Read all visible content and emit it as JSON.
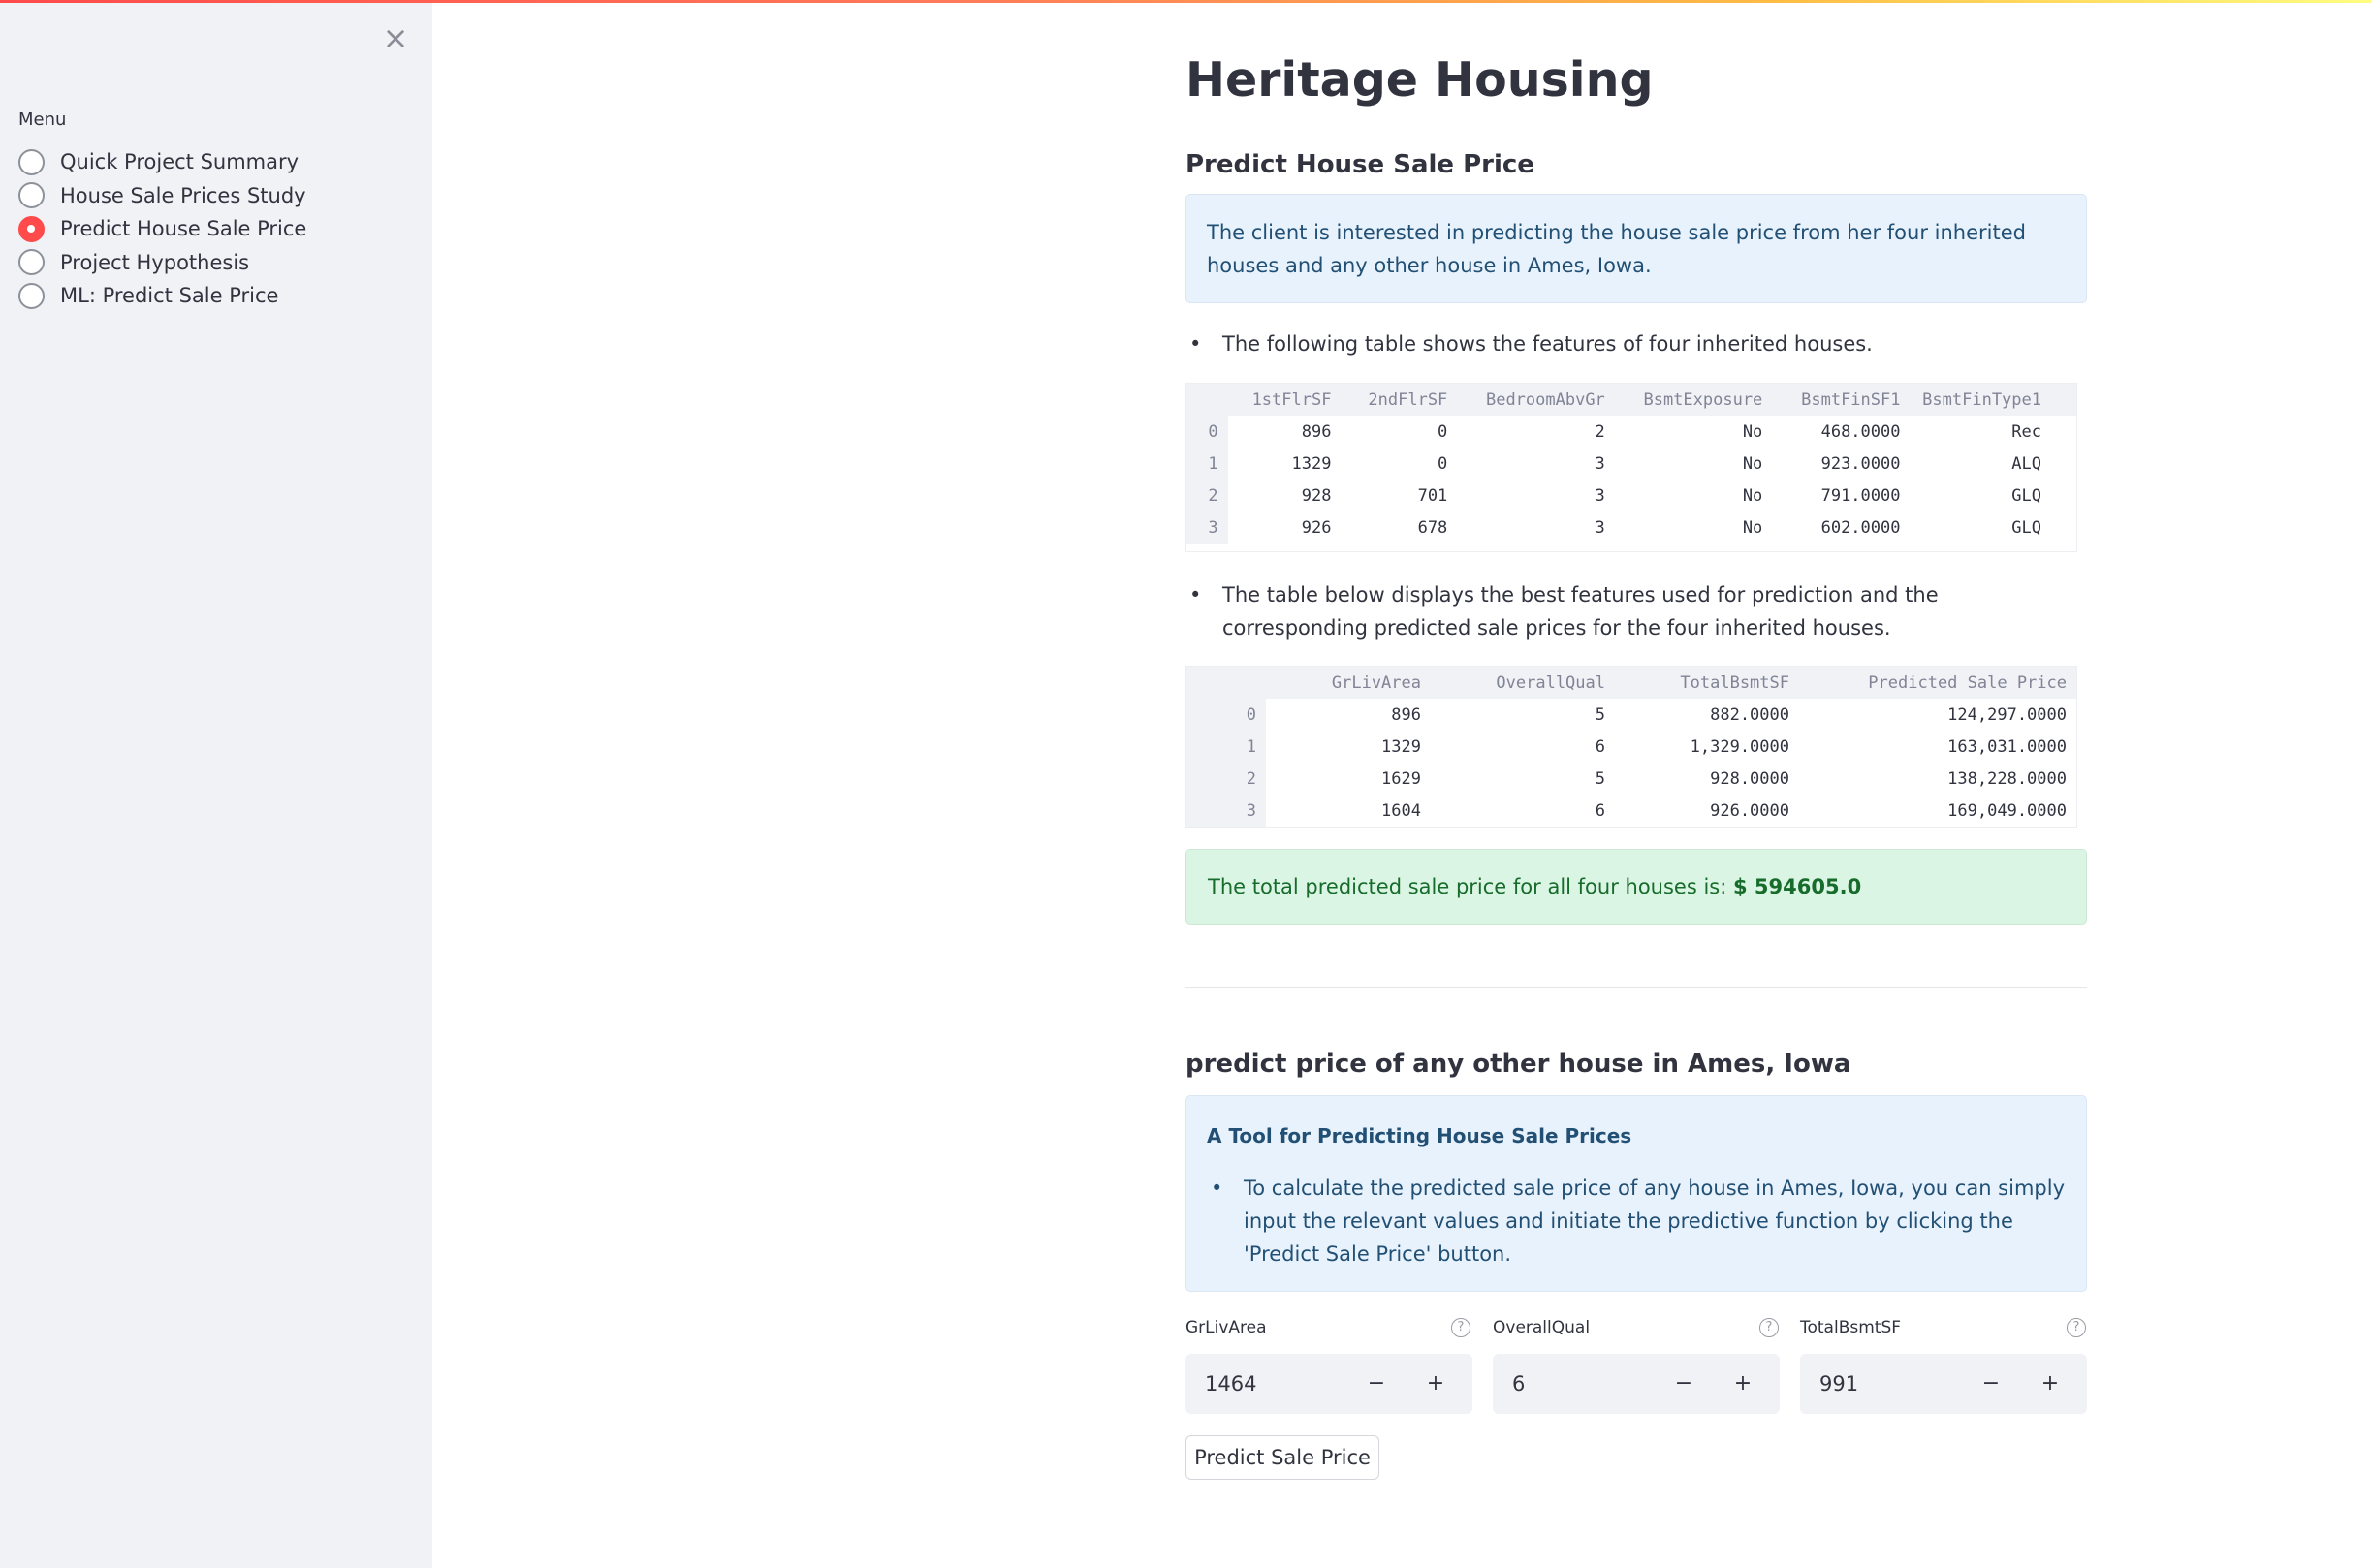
{
  "sidebar": {
    "close_icon": "×",
    "menu_label": "Menu",
    "items": [
      {
        "label": "Quick Project Summary",
        "selected": false
      },
      {
        "label": "House Sale Prices Study",
        "selected": false
      },
      {
        "label": "Predict House Sale Price",
        "selected": true
      },
      {
        "label": "Project Hypothesis",
        "selected": false
      },
      {
        "label": "ML: Predict Sale Price",
        "selected": false
      }
    ]
  },
  "main": {
    "title": "Heritage Housing",
    "subtitle": "Predict House Sale Price",
    "info_text": "The client is interested in predicting the house sale price from her four inherited houses and any other house in Ames, Iowa.",
    "bullet1": "The following table shows the features of four inherited houses.",
    "table1": {
      "columns": [
        "1stFlrSF",
        "2ndFlrSF",
        "BedroomAbvGr",
        "BsmtExposure",
        "BsmtFinSF1",
        "BsmtFinType1"
      ],
      "rows": [
        [
          "0",
          "896",
          "0",
          "2",
          "No",
          "468.0000",
          "Rec"
        ],
        [
          "1",
          "1329",
          "0",
          "3",
          "No",
          "923.0000",
          "ALQ"
        ],
        [
          "2",
          "928",
          "701",
          "3",
          "No",
          "791.0000",
          "GLQ"
        ],
        [
          "3",
          "926",
          "678",
          "3",
          "No",
          "602.0000",
          "GLQ"
        ]
      ]
    },
    "bullet2": "The table below displays the best features used for prediction and the corresponding predicted sale prices for the four inherited houses.",
    "table2": {
      "columns": [
        "GrLivArea",
        "OverallQual",
        "TotalBsmtSF",
        "Predicted Sale Price"
      ],
      "rows": [
        [
          "0",
          "896",
          "5",
          "882.0000",
          "124,297.0000"
        ],
        [
          "1",
          "1329",
          "6",
          "1,329.0000",
          "163,031.0000"
        ],
        [
          "2",
          "1629",
          "5",
          "928.0000",
          "138,228.0000"
        ],
        [
          "3",
          "1604",
          "6",
          "926.0000",
          "169,049.0000"
        ]
      ]
    },
    "total_prefix": "The total predicted sale price for all four houses is: ",
    "total_value": "$ 594605.0",
    "section2_title": "predict price of any other house in Ames, Iowa",
    "tool_title": "A Tool for Predicting House Sale Prices",
    "tool_text": "To calculate the predicted sale price of any house in Ames, Iowa, you can simply input the relevant values and initiate the predictive function by clicking the 'Predict Sale Price' button.",
    "inputs": [
      {
        "label": "GrLivArea",
        "value": "1464"
      },
      {
        "label": "OverallQual",
        "value": "6"
      },
      {
        "label": "TotalBsmtSF",
        "value": "991"
      }
    ],
    "help_glyph": "?",
    "minus_glyph": "−",
    "plus_glyph": "+",
    "predict_button": "Predict Sale Price"
  }
}
